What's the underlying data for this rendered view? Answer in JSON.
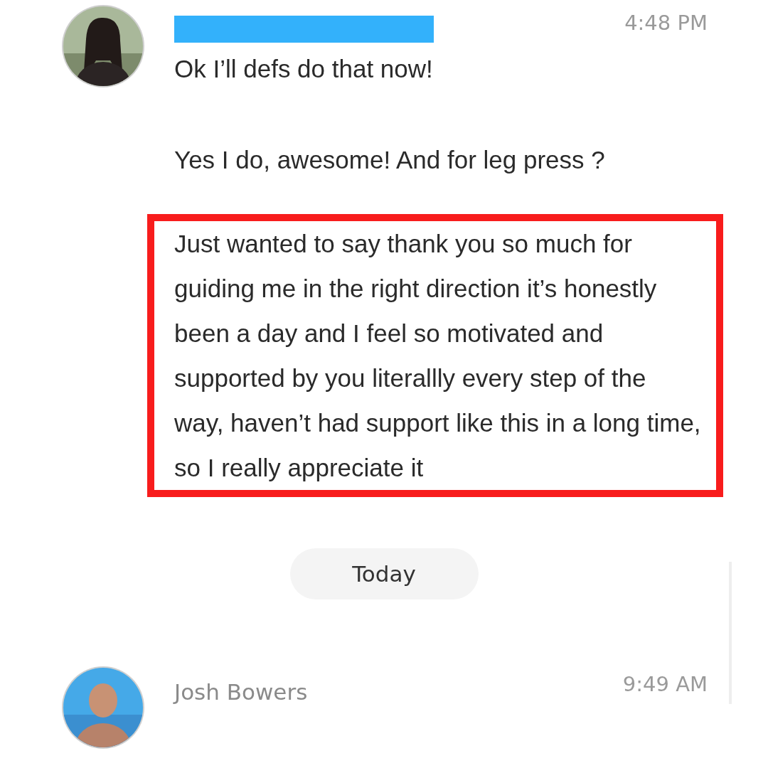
{
  "messages": [
    {
      "name_redacted": true,
      "time": "4:48 PM",
      "texts": [
        {
          "text": "Ok I’ll defs do that now!",
          "highlighted": false
        },
        {
          "text": "Yes I do, awesome! And for leg press ?",
          "highlighted": false
        },
        {
          "text": "Just wanted to say thank you so much for guiding me in the right direction it’s honestly been a day and I feel so motivated and supported by you literallly every step of the way, haven’t had support like this in a long time, so I really appreciate it",
          "highlighted": true
        }
      ]
    },
    {
      "divider": "Today"
    },
    {
      "name_redacted": false,
      "name": "Josh Bowers",
      "time": "9:49 AM"
    }
  ]
}
